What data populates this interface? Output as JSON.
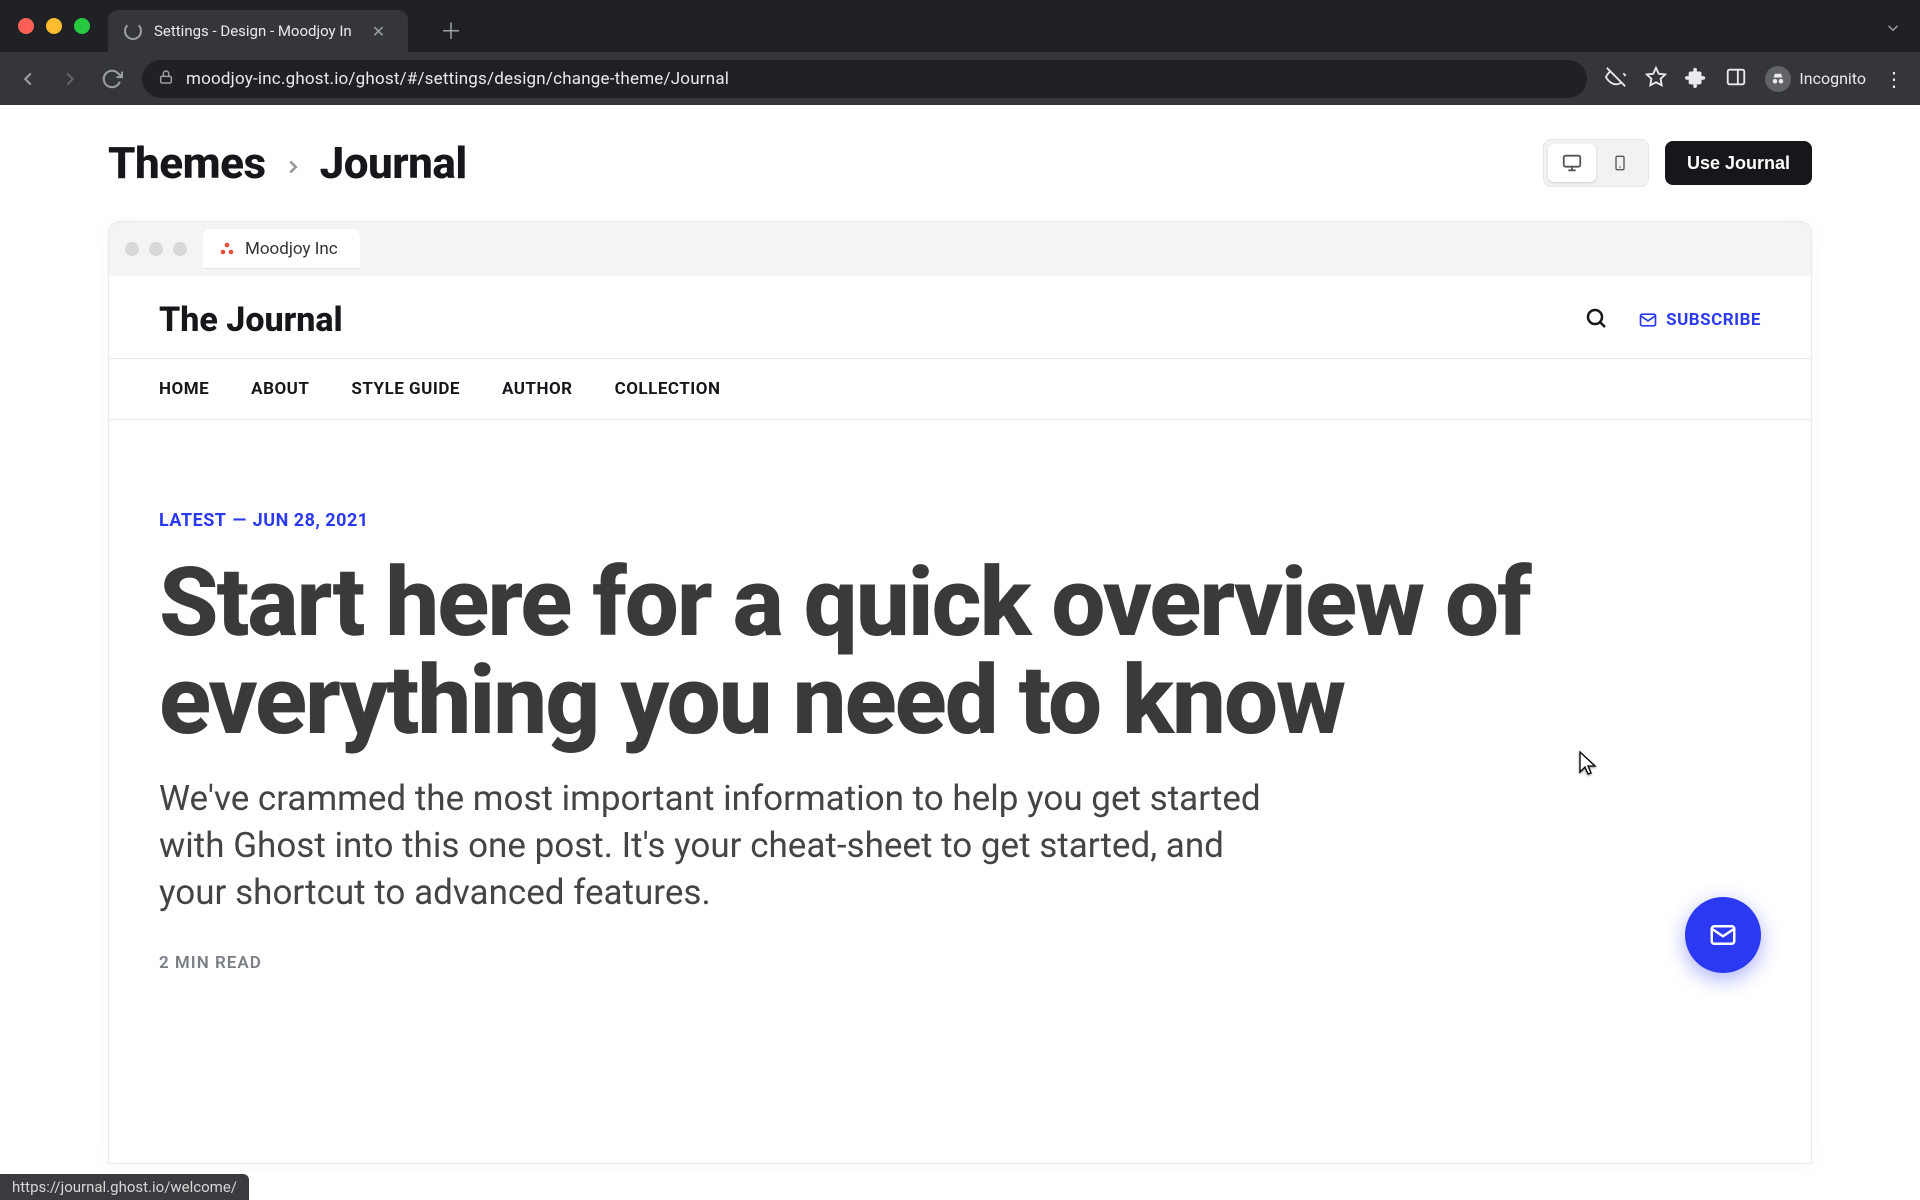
{
  "browser": {
    "tab_title": "Settings - Design - Moodjoy In",
    "url": "moodjoy-inc.ghost.io/ghost/#/settings/design/change-theme/Journal",
    "incognito_label": "Incognito"
  },
  "header": {
    "breadcrumb_parent": "Themes",
    "breadcrumb_child": "Journal",
    "use_button": "Use Journal"
  },
  "preview_tab": {
    "site_name": "Moodjoy Inc"
  },
  "site": {
    "title": "The Journal",
    "subscribe": "SUBSCRIBE",
    "nav": [
      "HOME",
      "ABOUT",
      "STYLE GUIDE",
      "AUTHOR",
      "COLLECTION"
    ]
  },
  "article": {
    "kicker_label": "LATEST",
    "kicker_date": "JUN 28, 2021",
    "headline": "Start here for a quick overview of everything you need to know",
    "dek": "We've crammed the most important information to help you get started with Ghost into this one post. It's your cheat-sheet to get started, and your shortcut to advanced features.",
    "read_time": "2 MIN READ"
  },
  "status_url": "https://journal.ghost.io/welcome/"
}
